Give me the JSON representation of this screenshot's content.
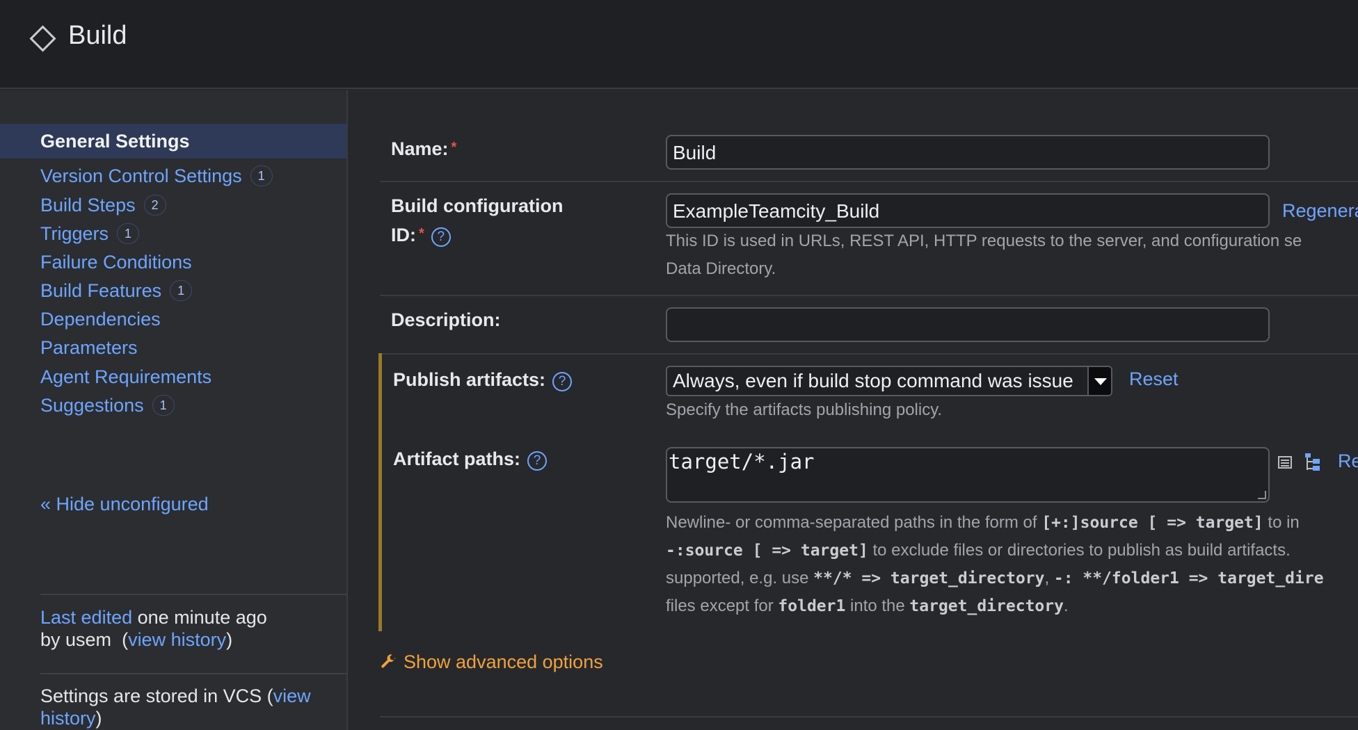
{
  "header": {
    "title": "Build",
    "icon": "diamond-icon"
  },
  "sidebar": {
    "items": [
      {
        "label": "General Settings",
        "badge": ""
      },
      {
        "label": "Version Control Settings",
        "badge": "1"
      },
      {
        "label": "Build Steps",
        "badge": "2"
      },
      {
        "label": "Triggers",
        "badge": "1"
      },
      {
        "label": "Failure Conditions",
        "badge": ""
      },
      {
        "label": "Build Features",
        "badge": "1"
      },
      {
        "label": "Dependencies",
        "badge": ""
      },
      {
        "label": "Parameters",
        "badge": ""
      },
      {
        "label": "Agent Requirements",
        "badge": ""
      },
      {
        "label": "Suggestions",
        "badge": "1"
      }
    ],
    "hide_unconfigured": "« Hide unconfigured",
    "last_edited_link": "Last edited",
    "last_edited_text": "one minute ago",
    "by_text": "by usem",
    "view_history": "view history",
    "vcs_text": "Settings are stored in VCS (",
    "vcs_link_1": "view",
    "vcs_link_2": "history",
    "close_paren": ")",
    "open_paren": "("
  },
  "form": {
    "name_label": "Name:",
    "name_value": "Build",
    "id_label_1": "Build configuration",
    "id_label_2": "ID:",
    "id_value": "ExampleTeamcity_Build",
    "regenerate": "Regenera",
    "id_hint_1": "This ID is used in URLs, REST API, HTTP requests to the server, and configuration se",
    "id_hint_2": "Data Directory.",
    "description_label": "Description:",
    "description_value": "",
    "publish_label": "Publish artifacts:",
    "publish_value": "Always, even if build stop command was issue",
    "reset": "Reset",
    "publish_hint": "Specify the artifacts publishing policy.",
    "paths_label": "Artifact paths:",
    "paths_value": "target/*.jar",
    "paths_link": "Re",
    "paths_hint": {
      "l1a": "Newline- or comma-separated paths in the form of ",
      "l1b": "[+:]source [ => target]",
      "l1c": " to in",
      "l2a": "-:source [ => target]",
      "l2b": " to exclude files or directories to publish as build artifacts. ",
      "l3a": "supported, e.g. use ",
      "l3b": "**/*",
      "l3c": " => target_directory",
      "l3d": ", ",
      "l3e": "-: **/folder1 => target_dire",
      "l4a": "files except for ",
      "l4b": "folder1",
      "l4c": " into the ",
      "l4d": "target_directory",
      "l4e": "."
    },
    "advanced": "Show advanced options",
    "required_mark": "*",
    "help_mark": "?"
  }
}
